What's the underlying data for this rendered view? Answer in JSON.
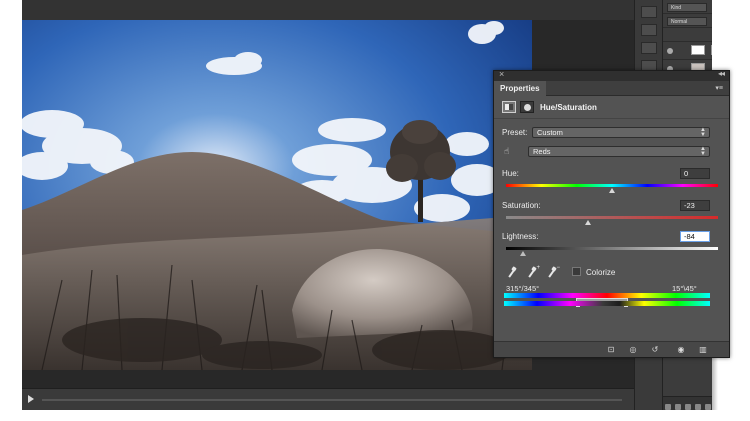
{
  "panel": {
    "tab_label": "Properties",
    "adjustment_title": "Hue/Saturation",
    "preset_label": "Preset:",
    "preset_value": "Custom",
    "channel_value": "Reds",
    "hue_label": "Hue:",
    "hue_value": "0",
    "hue_fraction": 0.5,
    "saturation_label": "Saturation:",
    "saturation_value": "-23",
    "saturation_fraction": 0.385,
    "lightness_label": "Lightness:",
    "lightness_value": "-84",
    "lightness_fraction": 0.08,
    "colorize_label": "Colorize",
    "colorize_checked": false,
    "range_left_label": "315°/345°",
    "range_right_label": "15°\\45°",
    "icons": {
      "close": "close-icon",
      "collapse": "double-chevron-icon",
      "menu": "panel-menu-icon",
      "adjustment": "hue-saturation-icon",
      "mask": "layer-mask-icon",
      "target": "on-image-adjust-hand-icon",
      "dropper": "eyedropper-icon",
      "dropper_add": "eyedropper-plus-icon",
      "dropper_sub": "eyedropper-minus-icon",
      "clip": "clip-to-layer-icon",
      "view_prev": "view-previous-state-icon",
      "reset": "reset-icon",
      "visibility": "eye-icon",
      "delete": "trash-icon"
    }
  },
  "layers": {
    "kind_filter": "Kind",
    "blend_mode": "Normal",
    "colors": {
      "workspace": "#2b2b2b",
      "panel": "#535353",
      "accent": "#6aa0e8"
    }
  }
}
